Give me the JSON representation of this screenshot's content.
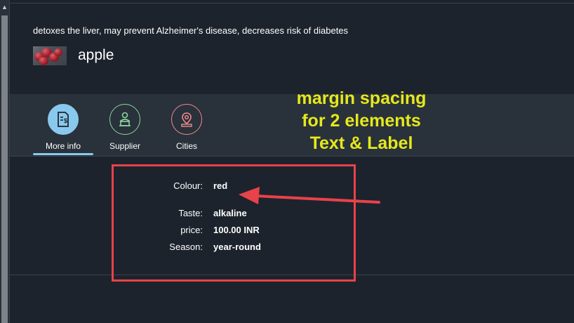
{
  "header": {
    "subtitle": "detoxes the liver, may prevent Alzheimer's disease, decreases risk of diabetes",
    "title": "apple",
    "image_icon": "apples-photo"
  },
  "tabs": [
    {
      "label": "More info",
      "icon": "document-dollar-icon",
      "selected": true,
      "color": "#89c9ee"
    },
    {
      "label": "Supplier",
      "icon": "supplier-person-icon",
      "selected": false,
      "color": "#8cd6a1"
    },
    {
      "label": "Cities",
      "icon": "location-pin-icon",
      "selected": false,
      "color": "#f08a8f"
    }
  ],
  "annotation": {
    "line1": "margin spacing",
    "line2": "for 2 elements",
    "line3": "Text & Label",
    "color": "#e5e81c"
  },
  "details": {
    "colour": {
      "label": "Colour:",
      "value": "red"
    },
    "taste": {
      "label": "Taste:",
      "value": "alkaline"
    },
    "price": {
      "label": "price:",
      "value": "100.00 INR"
    },
    "season": {
      "label": "Season:",
      "value": "year-round"
    }
  },
  "highlight_color": "#e8424a",
  "scrollbar": {
    "arrow_icon": "scroll-up-arrow-icon"
  }
}
